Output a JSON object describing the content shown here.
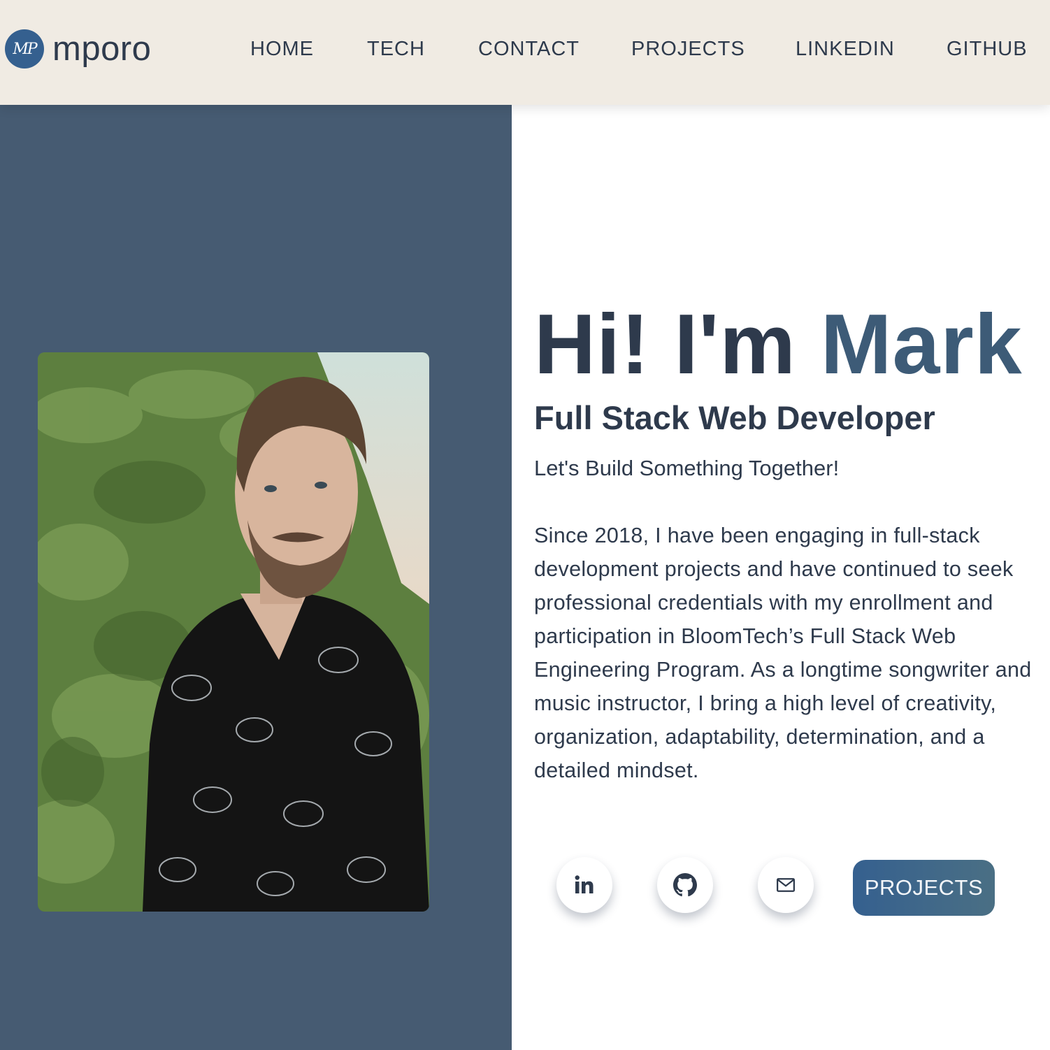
{
  "brand": {
    "logo_text": "MP",
    "name": "mporo"
  },
  "nav": {
    "home": "HOME",
    "tech": "TECH",
    "contact": "CONTACT",
    "projects": "PROJECTS",
    "linkedin": "LINKEDIN",
    "github": "GITHUB"
  },
  "hero": {
    "greeting": "Hi! I'm ",
    "name": "Mark",
    "role": "Full Stack Web Developer",
    "tagline": "Let's Build Something Together!",
    "bio": "Since 2018, I have been engaging in full-stack development projects and have continued to seek professional credentials with my enrollment and participation in BloomTech’s Full Stack Web Engineering Program. As a longtime songwriter and music instructor, I bring a high level of creativity, organization, adaptability, determination, and a detailed mindset."
  },
  "social": {
    "icons": [
      "linkedin-icon",
      "github-icon",
      "mail-icon"
    ]
  },
  "cta": {
    "projects_label": "PROJECTS"
  },
  "colors": {
    "navbar_bg": "#f0ebe3",
    "panel_bg": "#465b72",
    "text_dark": "#2e3a4c",
    "accent": "#35608f",
    "name_accent": "#3d5b77"
  }
}
